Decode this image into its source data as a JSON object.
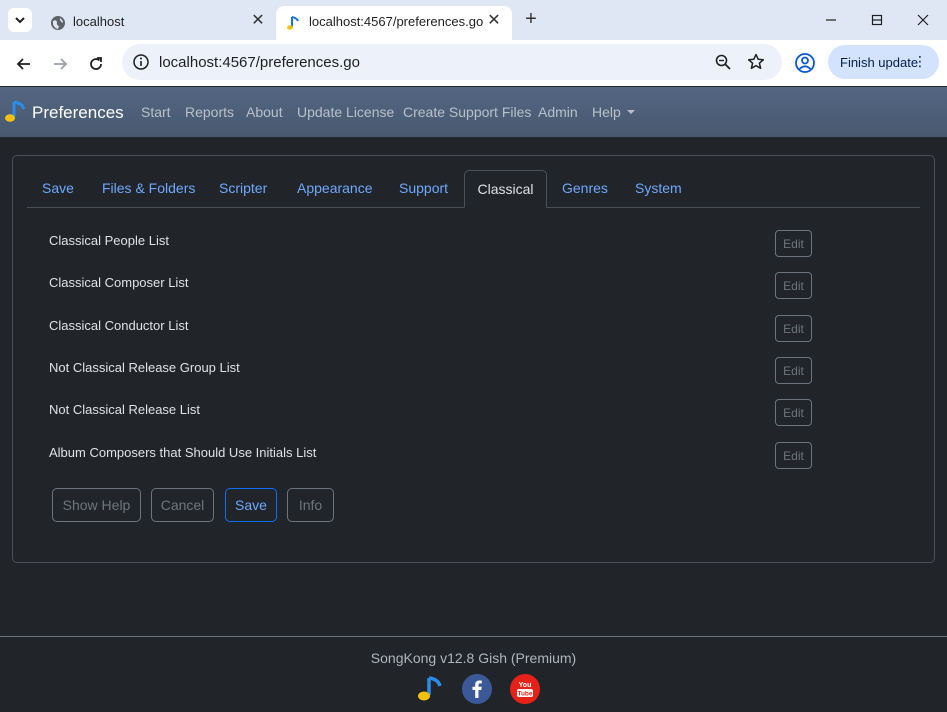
{
  "browser": {
    "tabs": [
      {
        "title": "localhost"
      },
      {
        "title": "localhost:4567/preferences.go"
      }
    ],
    "url": "localhost:4567/preferences.go",
    "update_button": "Finish update",
    "new_tab_symbol": "+",
    "close_symbol": "✕"
  },
  "navbar": {
    "brand": "Preferences",
    "items": [
      "Start",
      "Reports",
      "About",
      "Update License",
      "Create Support Files",
      "Admin"
    ],
    "help": "Help"
  },
  "pref_tabs": [
    "Save",
    "Files & Folders",
    "Scripter",
    "Appearance",
    "Support",
    "Classical",
    "Genres",
    "System"
  ],
  "active_tab": "Classical",
  "rows": [
    {
      "label": "Classical People List",
      "action": "Edit"
    },
    {
      "label": "Classical Composer List",
      "action": "Edit"
    },
    {
      "label": "Classical Conductor List",
      "action": "Edit"
    },
    {
      "label": "Not Classical Release Group List",
      "action": "Edit"
    },
    {
      "label": "Not Classical Release List",
      "action": "Edit"
    },
    {
      "label": "Album Composers that Should Use Initials List",
      "action": "Edit"
    }
  ],
  "actions": {
    "show_help": "Show Help",
    "cancel": "Cancel",
    "save": "Save",
    "info": "Info"
  },
  "footer": {
    "version": "SongKong v12.8 Gish (Premium)"
  },
  "colors": {
    "page_bg": "#212529",
    "navbar_bg": "#4b5c74",
    "link": "#6ea8fe",
    "primary": "#0d6efd",
    "muted": "#6c757d",
    "facebook": "#3b5998",
    "youtube": "#e62117"
  }
}
